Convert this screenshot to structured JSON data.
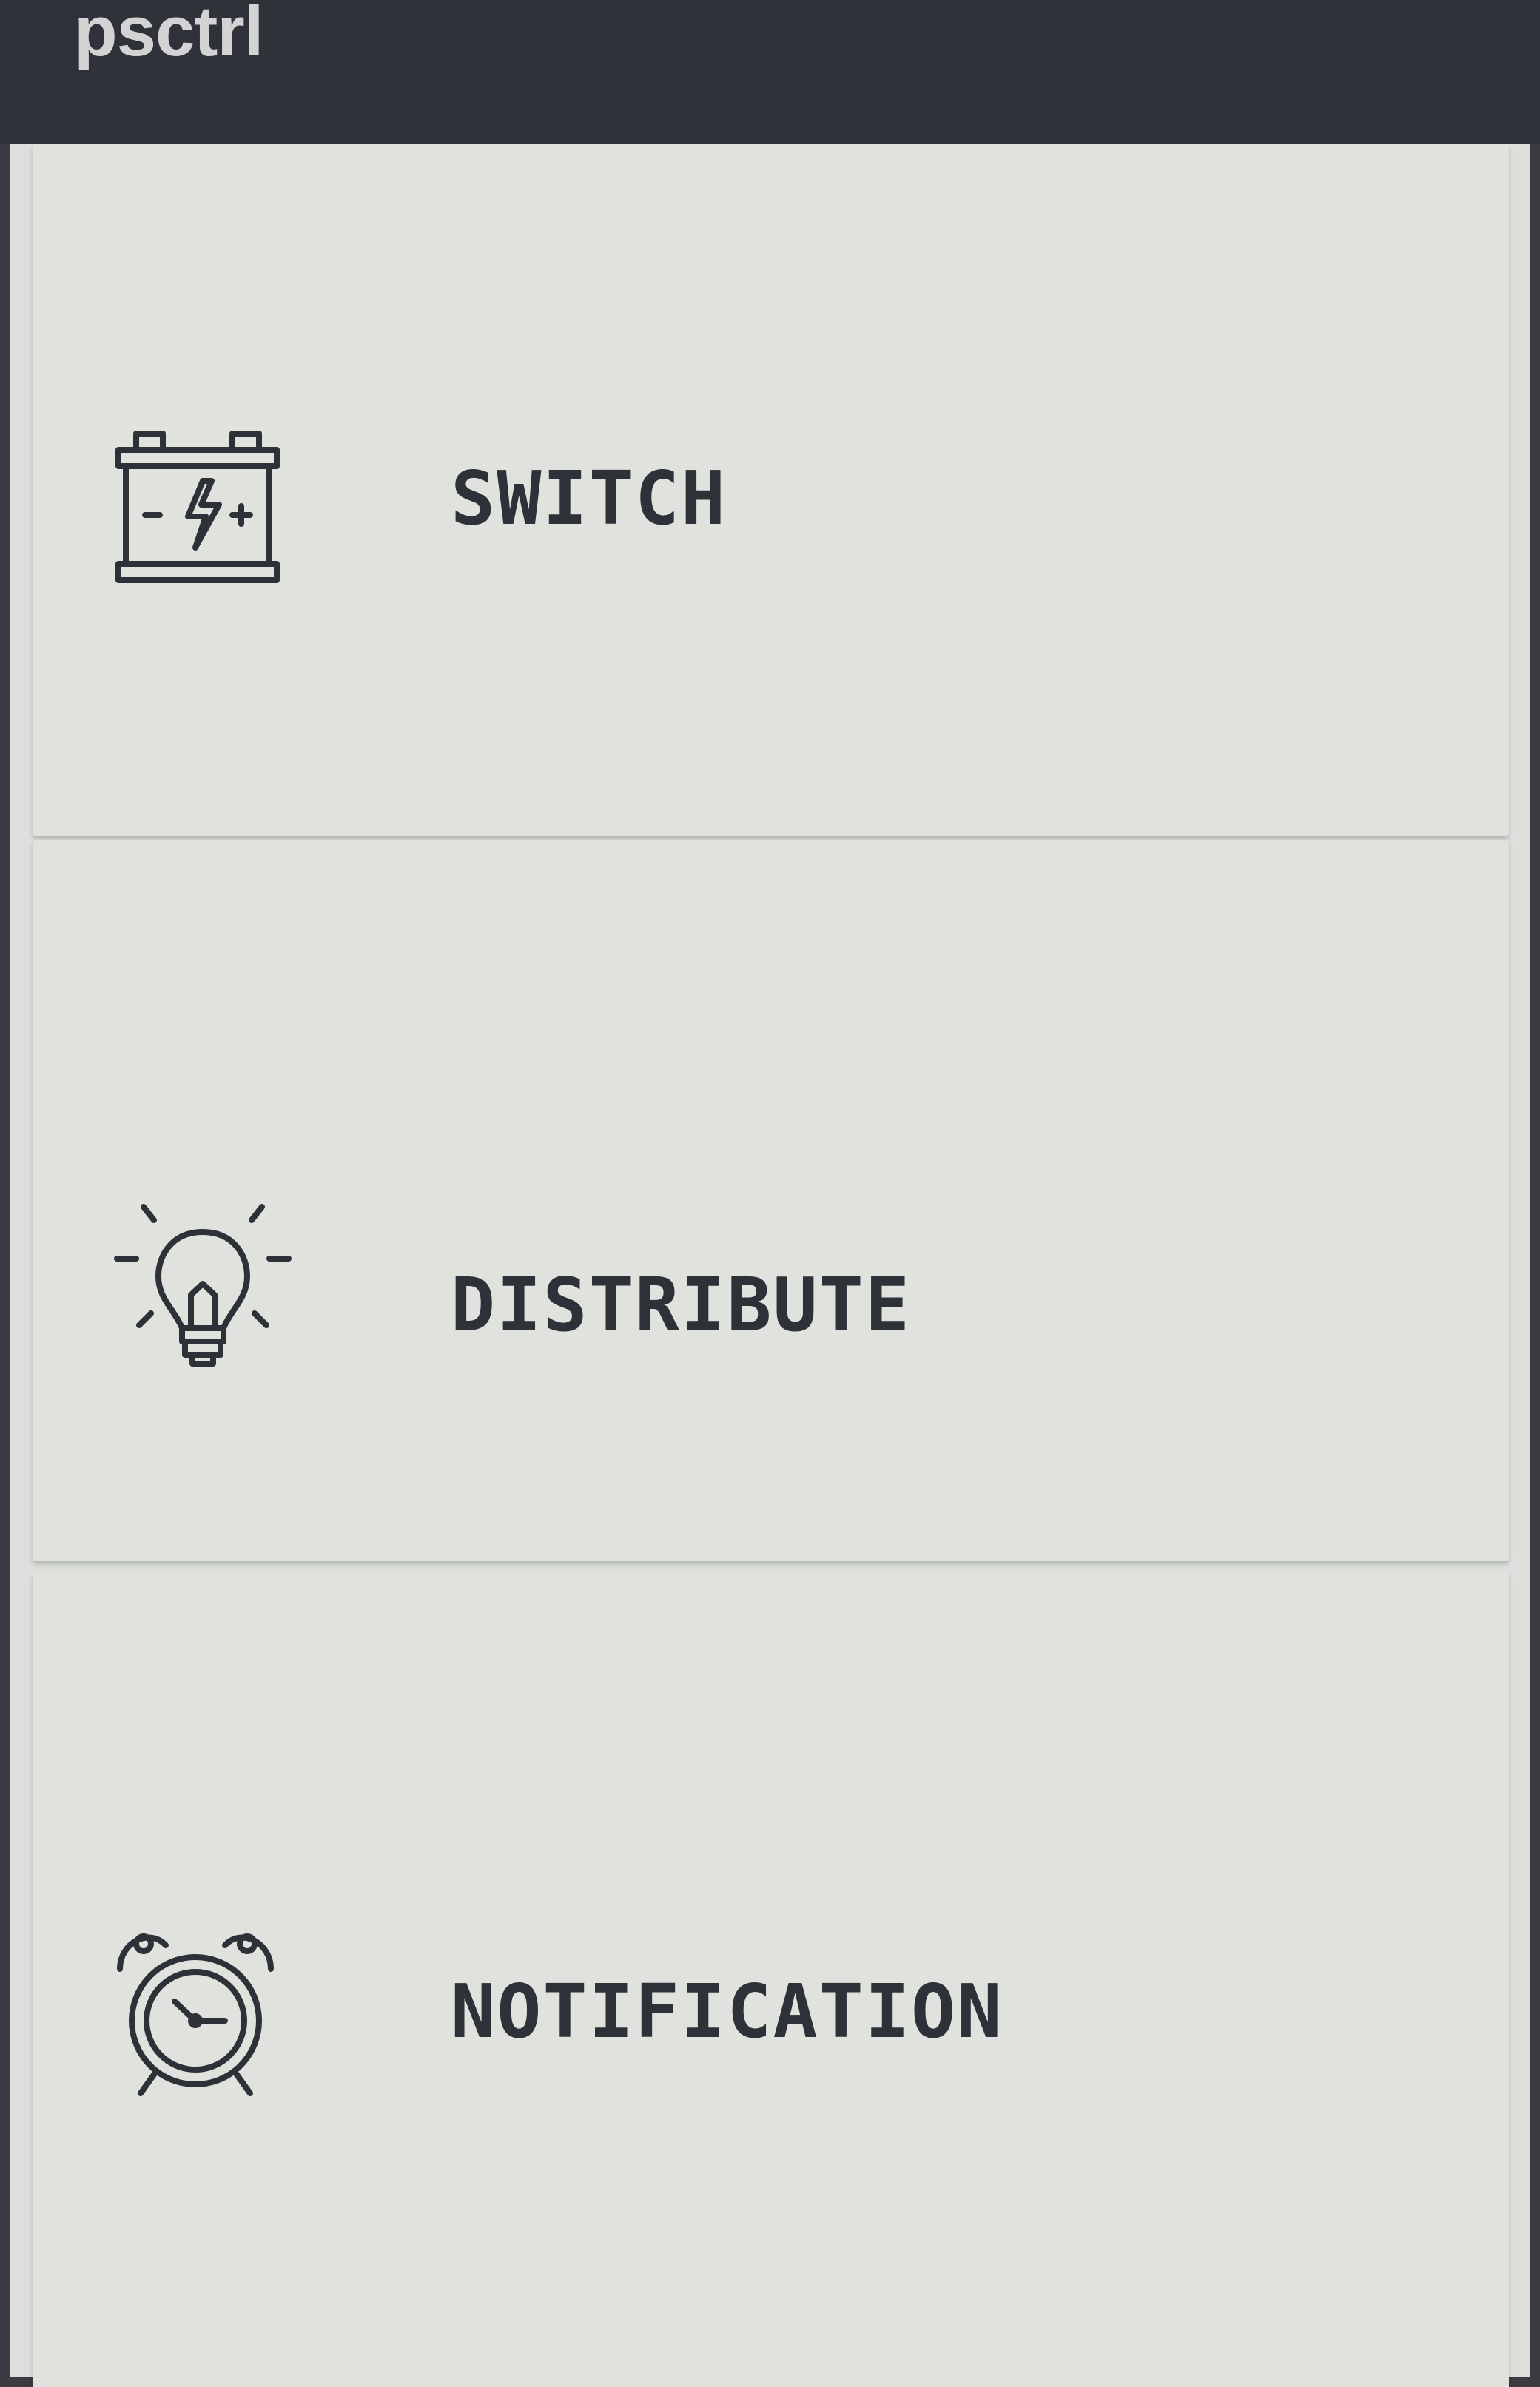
{
  "app": {
    "title": "psctrl"
  },
  "menu": {
    "items": [
      {
        "label": "SWITCH",
        "icon": "battery-icon"
      },
      {
        "label": "DISTRIBUTE",
        "icon": "lightbulb-icon"
      },
      {
        "label": "NOTIFICATION",
        "icon": "alarm-clock-icon"
      }
    ]
  },
  "colors": {
    "titlebar": "#30323a",
    "background": "#dcdfdb",
    "card": "#e0e2de",
    "text": "#2f3138"
  }
}
